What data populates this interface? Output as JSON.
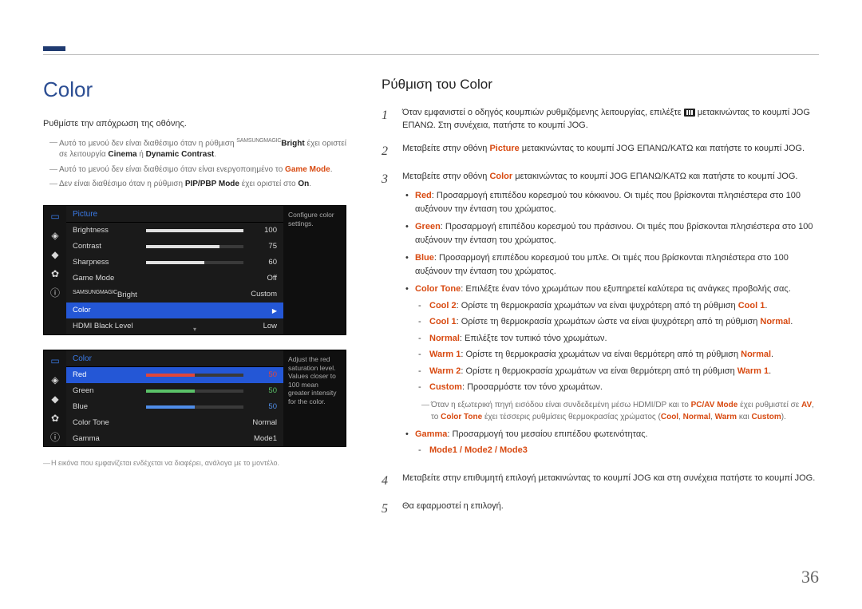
{
  "page_number": "36",
  "left": {
    "title": "Color",
    "lead": "Ρυθμίστε την απόχρωση της οθόνης.",
    "note1_a": "Αυτό το μενού δεν είναι διαθέσιμο όταν η ρύθμιση ",
    "note1_magic_prefix": "SAMSUNG",
    "note1_magic_suffix": "MAGIC",
    "note1_bright": "Bright",
    "note1_b": " έχει οριστεί σε λειτουργία ",
    "note1_cinema": "Cinema",
    "note1_or": " ή ",
    "note1_dc": "Dynamic Contrast",
    "note1_end": ".",
    "note2_a": "Αυτό το μενού δεν είναι διαθέσιμο όταν είναι ενεργοποιημένο το ",
    "note2_gm": "Game Mode",
    "note2_end": ".",
    "note3_a": "Δεν είναι διαθέσιμο όταν η ρύθμιση ",
    "note3_pip": "PIP/PBP Mode",
    "note3_b": " έχει οριστεί στο ",
    "note3_on": "On",
    "note3_end": ".",
    "footnote": "Η εικόνα που εμφανίζεται ενδέχεται να διαφέρει, ανάλογα με το μοντέλο."
  },
  "osd1": {
    "header": "Picture",
    "help": "Configure color settings.",
    "rows": {
      "brightness": {
        "label": "Brightness",
        "value": "100",
        "pct": 100
      },
      "contrast": {
        "label": "Contrast",
        "value": "75",
        "pct": 75
      },
      "sharpness": {
        "label": "Sharpness",
        "value": "60",
        "pct": 60
      },
      "gamemode": {
        "label": "Game Mode",
        "value": "Off"
      },
      "magicbright": {
        "label": "Bright",
        "prefix": "SAMSUNG",
        "prefix2": "MAGIC",
        "value": "Custom"
      },
      "color": {
        "label": "Color"
      },
      "hdmiblack": {
        "label": "HDMI Black Level",
        "value": "Low"
      }
    }
  },
  "osd2": {
    "header": "Color",
    "help": "Adjust the red saturation level. Values closer to 100 mean greater intensity for the color.",
    "rows": {
      "red": {
        "label": "Red",
        "value": "50",
        "pct": 50
      },
      "green": {
        "label": "Green",
        "value": "50",
        "pct": 50
      },
      "blue": {
        "label": "Blue",
        "value": "50",
        "pct": 50
      },
      "tone": {
        "label": "Color Tone",
        "value": "Normal"
      },
      "gamma": {
        "label": "Gamma",
        "value": "Mode1"
      }
    }
  },
  "right": {
    "title": "Ρύθμιση του Color",
    "step1_a": "Όταν εμφανιστεί ο οδηγός κουμπιών ρυθμιζόμενης λειτουργίας, επιλέξτε ",
    "step1_b": " μετακινώντας το κουμπί JOG ΕΠΑΝΩ. Στη συνέχεια, πατήστε το κουμπί JOG.",
    "step2_a": "Μεταβείτε στην οθόνη ",
    "step2_pic": "Picture",
    "step2_b": " μετακινώντας το κουμπί JOG ΕΠΑΝΩ/ΚΑΤΩ και πατήστε το κουμπί JOG.",
    "step3_a": "Μεταβείτε στην οθόνη ",
    "step3_col": "Color",
    "step3_b": " μετακινώντας το κουμπί JOG ΕΠΑΝΩ/ΚΑΤΩ και πατήστε το κουμπί JOG.",
    "red_k": "Red",
    "red_t": ": Προσαρμογή επιπέδου κορεσμού του κόκκινου. Οι τιμές που βρίσκονται πλησιέστερα στο 100 αυξάνουν την ένταση του χρώματος.",
    "green_k": "Green",
    "green_t": ": Προσαρμογή επιπέδου κορεσμού του πράσινου. Οι τιμές που βρίσκονται πλησιέστερα στο 100 αυξάνουν την ένταση του χρώματος.",
    "blue_k": "Blue",
    "blue_t": ": Προσαρμογή επιπέδου κορεσμού του μπλε. Οι τιμές που βρίσκονται πλησιέστερα στο 100 αυξάνουν την ένταση του χρώματος.",
    "tone_k": "Color Tone",
    "tone_t": ": Επιλέξτε έναν τόνο χρωμάτων που εξυπηρετεί καλύτερα τις ανάγκες προβολής σας.",
    "cool2_k": "Cool 2",
    "cool2_t": ": Ορίστε τη θερμοκρασία χρωμάτων να είναι ψυχρότερη από τη ρύθμιση ",
    "cool2_ref": "Cool 1",
    "cool1_k": "Cool 1",
    "cool1_t": ": Ορίστε τη θερμοκρασία χρωμάτων ώστε να είναι ψυχρότερη από τη ρύθμιση ",
    "cool1_ref": "Normal",
    "normal_k": "Normal",
    "normal_t": ": Επιλέξτε τον τυπικό τόνο χρωμάτων.",
    "warm1_k": "Warm 1",
    "warm1_t": ": Ορίστε τη θερμοκρασία χρωμάτων να είναι θερμότερη από τη ρύθμιση ",
    "warm1_ref": "Normal",
    "warm2_k": "Warm 2",
    "warm2_t": ": Ορίστε η θερμοκρασία χρωμάτων να είναι θερμότερη από τη ρύθμιση ",
    "warm2_ref": "Warm 1",
    "custom_k": "Custom",
    "custom_t": ": Προσαρμόστε τον τόνο χρωμάτων.",
    "hdmi_note_a": "Όταν η εξωτερική πηγή εισόδου είναι συνδεδεμένη μέσω HDMI/DP και το ",
    "hdmi_pcav": "PC/AV Mode",
    "hdmi_note_b": " έχει ρυθμιστεί σε ",
    "hdmi_av": "AV",
    "hdmi_note_c": ", το ",
    "hdmi_ct": "Color Tone",
    "hdmi_note_d": " έχει τέσσερις ρυθμίσεις θερμοκρασίας χρώματος (",
    "hdmi_cool": "Cool",
    "hdmi_sep1": ", ",
    "hdmi_normal": "Normal",
    "hdmi_sep2": ", ",
    "hdmi_warm": "Warm",
    "hdmi_sep3": " και ",
    "hdmi_custom": "Custom",
    "hdmi_note_e": ").",
    "gamma_k": "Gamma",
    "gamma_t": ": Προσαρμογή του μεσαίου επιπέδου φωτεινότητας.",
    "gamma_modes": "Mode1 / Mode2 / Mode3",
    "step4": "Μεταβείτε στην επιθυμητή επιλογή μετακινώντας το κουμπί JOG και στη συνέχεια πατήστε το κουμπί JOG.",
    "step5": "Θα εφαρμοστεί η επιλογή."
  }
}
